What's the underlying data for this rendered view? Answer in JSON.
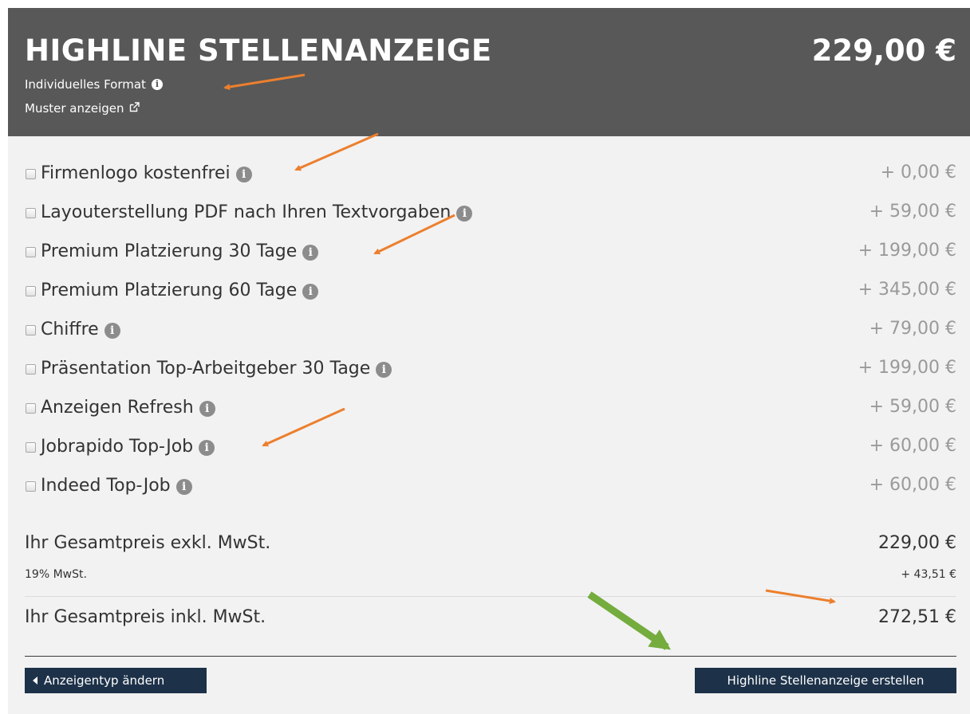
{
  "header": {
    "title": "HIGHLINE STELLENANZEIGE",
    "price": "229,00 €",
    "format_label": "Individuelles Format",
    "format_info_icon": "info-icon",
    "muster_link": "Muster anzeigen",
    "muster_icon": "external-link-icon"
  },
  "options": [
    {
      "label": "Firmenlogo kostenfrei",
      "price": "+ 0,00 €",
      "checked": false
    },
    {
      "label": "Layouterstellung PDF nach Ihren Textvorgaben",
      "price": "+ 59,00 €",
      "checked": false
    },
    {
      "label": "Premium Platzierung 30 Tage",
      "price": "+ 199,00 €",
      "checked": false
    },
    {
      "label": "Premium Platzierung 60 Tage",
      "price": "+ 345,00 €",
      "checked": false
    },
    {
      "label": "Chiffre",
      "price": "+ 79,00 €",
      "checked": false
    },
    {
      "label": "Präsentation Top-Arbeitgeber 30 Tage",
      "price": "+ 199,00 €",
      "checked": false
    },
    {
      "label": "Anzeigen Refresh",
      "price": "+ 59,00 €",
      "checked": false
    },
    {
      "label": "Jobrapido Top-Job",
      "price": "+ 60,00 €",
      "checked": false
    },
    {
      "label": "Indeed Top-Job",
      "price": "+ 60,00 €",
      "checked": false
    }
  ],
  "totals": {
    "net_label": "Ihr Gesamtpreis exkl. MwSt.",
    "net_value": "229,00 €",
    "vat_label": "19% MwSt.",
    "vat_value": "+ 43,51 €",
    "gross_label": "Ihr Gesamtpreis inkl. MwSt.",
    "gross_value": "272,51 €"
  },
  "actions": {
    "back_label": "Anzeigentyp ändern",
    "create_label": "Highline Stellenanzeige erstellen"
  },
  "colors": {
    "header_bg": "#585858",
    "panel_bg": "#f2f2f2",
    "button_bg": "#1d3249",
    "annotation_orange": "#ec7f2e",
    "annotation_green": "#74ac3d"
  }
}
